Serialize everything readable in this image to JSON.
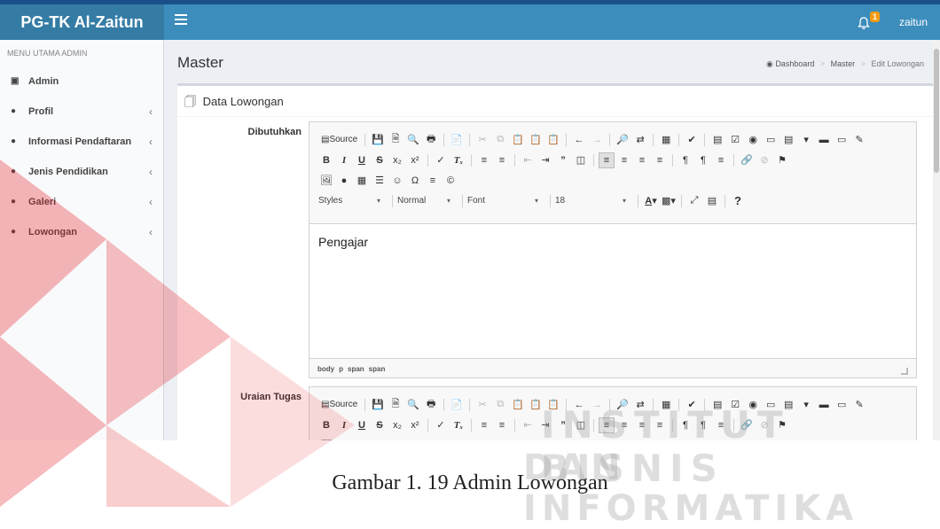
{
  "app": {
    "brand": "PG-TK Al-Zaitun",
    "username": "zaitun",
    "notif_count": "1"
  },
  "sidebar": {
    "header": "MENU UTAMA ADMIN",
    "items": [
      {
        "label": "Admin",
        "icon": "lock-icon",
        "chevron": ""
      },
      {
        "label": "Profil",
        "icon": "users-icon",
        "chevron": "‹"
      },
      {
        "label": "Informasi Pendaftaran",
        "icon": "users-icon",
        "chevron": "‹"
      },
      {
        "label": "Jenis Pendidikan",
        "icon": "users-icon",
        "chevron": "‹"
      },
      {
        "label": "Galeri",
        "icon": "users-icon",
        "chevron": "‹"
      },
      {
        "label": "Lowongan",
        "icon": "users-icon",
        "chevron": "‹"
      }
    ]
  },
  "content": {
    "title": "Master",
    "breadcrumb": [
      "Dashboard",
      "Master",
      "Edit Lowongan"
    ],
    "box_title": "Data Lowongan"
  },
  "form": {
    "fields": [
      {
        "label": "Dibutuhkan",
        "value": "Pengajar",
        "path": [
          "body",
          "p",
          "span",
          "span"
        ]
      },
      {
        "label": "Uraian Tugas",
        "value": "",
        "path": []
      }
    ]
  },
  "editor_toolbar": {
    "source_label": "Source",
    "styles_label": "Styles",
    "format_label": "Normal",
    "font_label": "Font",
    "size_label": "18",
    "help_label": "?"
  },
  "caption": "Gambar 1. 19 Admin Lowongan",
  "watermark": {
    "line1": "INSTITUT BISNIS",
    "line2": "DAN INFORMATIKA"
  },
  "colors": {
    "navbar": "#3c8dbc",
    "brand_bg": "#357ca5",
    "sidebar_bg": "#f9fafc",
    "badge": "#f39c12",
    "watermark_red": "#e31e24"
  }
}
